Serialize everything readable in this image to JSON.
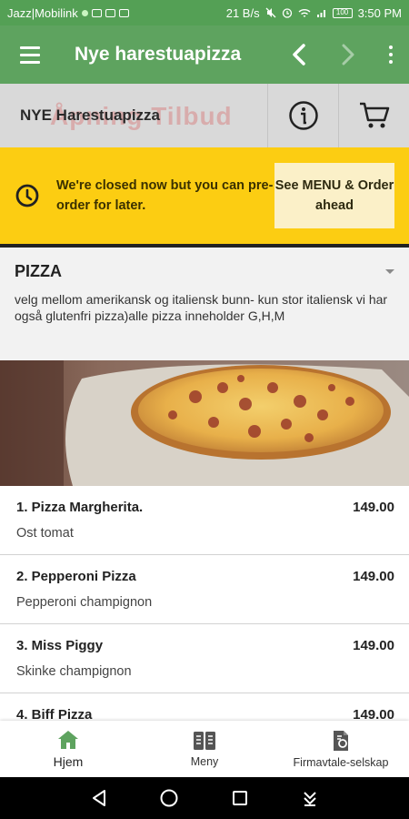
{
  "status_bar": {
    "carrier": "Jazz|Mobilink",
    "net_speed": "21 B/s",
    "battery": "100",
    "time": "3:50 PM"
  },
  "app_bar": {
    "title": "Nye harestuapizza",
    "icons": [
      "menu-icon",
      "chevron-left-icon",
      "chevron-right-icon",
      "more-vert-icon"
    ]
  },
  "store_bar": {
    "name": "NYE Harestuapizza",
    "background_text": "Åpning Tilbud",
    "icons": [
      "info-icon",
      "cart-icon"
    ]
  },
  "notice": {
    "message": "We're closed now but you can pre-order for later.",
    "button_label": "See MENU & Order ahead",
    "background_color": "#fccd12",
    "icon": "clock-icon"
  },
  "category": {
    "title": "PIZZA",
    "description": "velg mellom amerikansk og italiensk bunn- kun stor italiensk vi har også glutenfri pizza)alle pizza inneholder G,H,M"
  },
  "menu_items": [
    {
      "name": "1. Pizza Margherita.",
      "price": "149.00",
      "description": "Ost tomat"
    },
    {
      "name": "2. Pepperoni Pizza",
      "price": "149.00",
      "description": "Pepperoni champignon"
    },
    {
      "name": "3. Miss Piggy",
      "price": "149.00",
      "description": "Skinke champignon"
    },
    {
      "name": "4. Biff Pizza",
      "price": "149.00",
      "description": ""
    }
  ],
  "bottom_nav": {
    "items": [
      {
        "label": "Hjem",
        "icon": "home-icon",
        "active": true
      },
      {
        "label": "Meny",
        "icon": "menu-book-icon",
        "active": false
      },
      {
        "label": "Firmavtale-selskap",
        "icon": "document-icon",
        "active": false
      }
    ]
  },
  "colors": {
    "primary_green": "#5ea35f",
    "accent_yellow": "#fccd12"
  }
}
